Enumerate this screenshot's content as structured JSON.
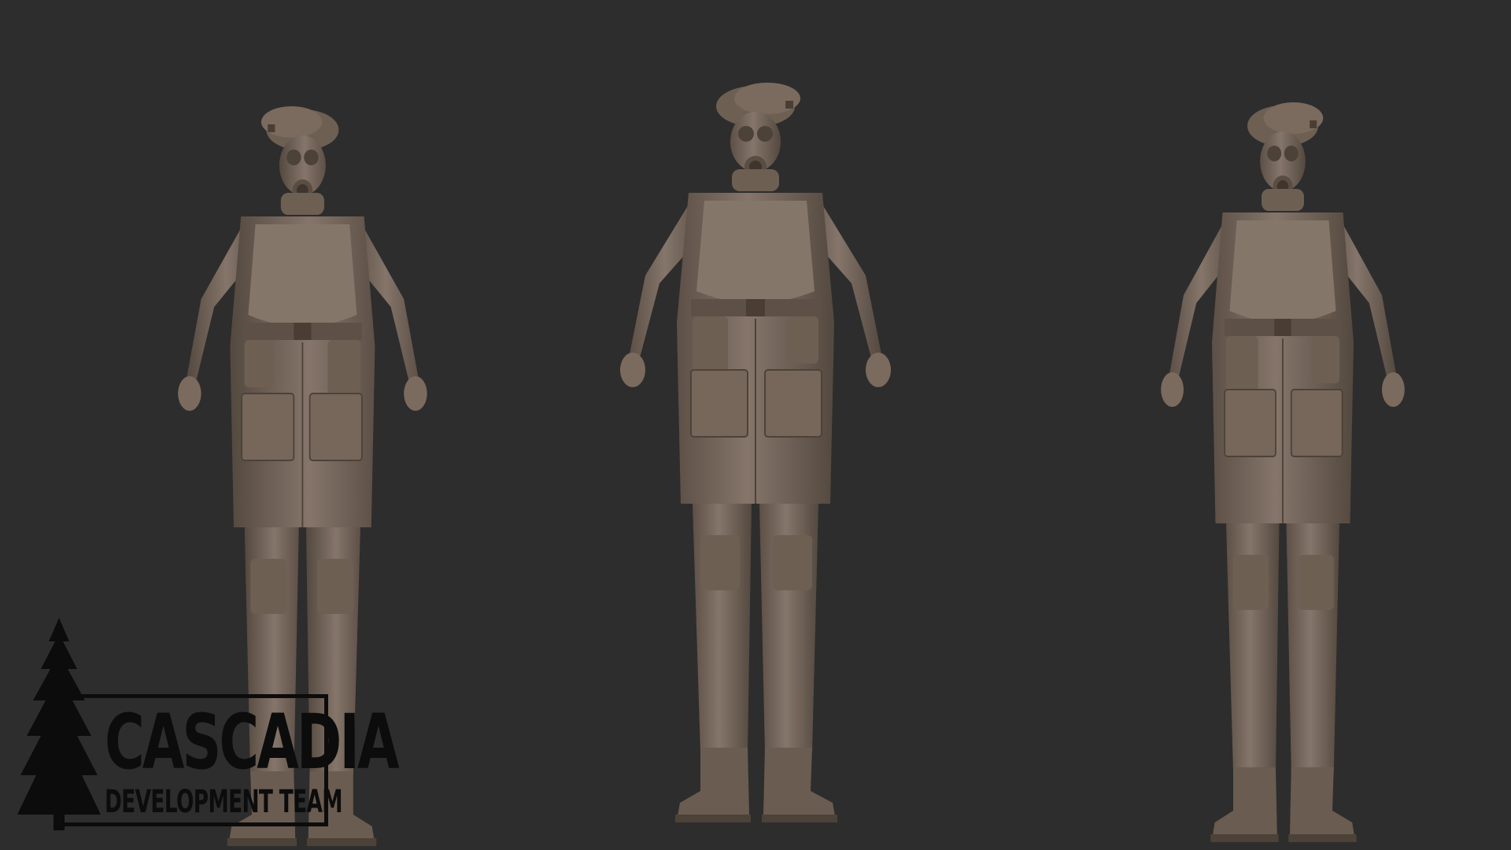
{
  "scene": {
    "background": "#2d2d2d",
    "model_color": "#7a6a5b",
    "model_shadow": "#4d4238",
    "model_highlight": "#9a8979",
    "subject": "Sculpted 3D character: soldier in beret, gas mask, body armor, long coat, cargo trousers and boots",
    "views": [
      {
        "name": "three-quarter-left-view"
      },
      {
        "name": "front-view"
      },
      {
        "name": "three-quarter-right-view"
      }
    ]
  },
  "logo": {
    "title": "CASCADIA",
    "subtitle": "DEVELOPMENT TEAM",
    "color": "#0c0c0c",
    "icon": "tree-icon"
  }
}
